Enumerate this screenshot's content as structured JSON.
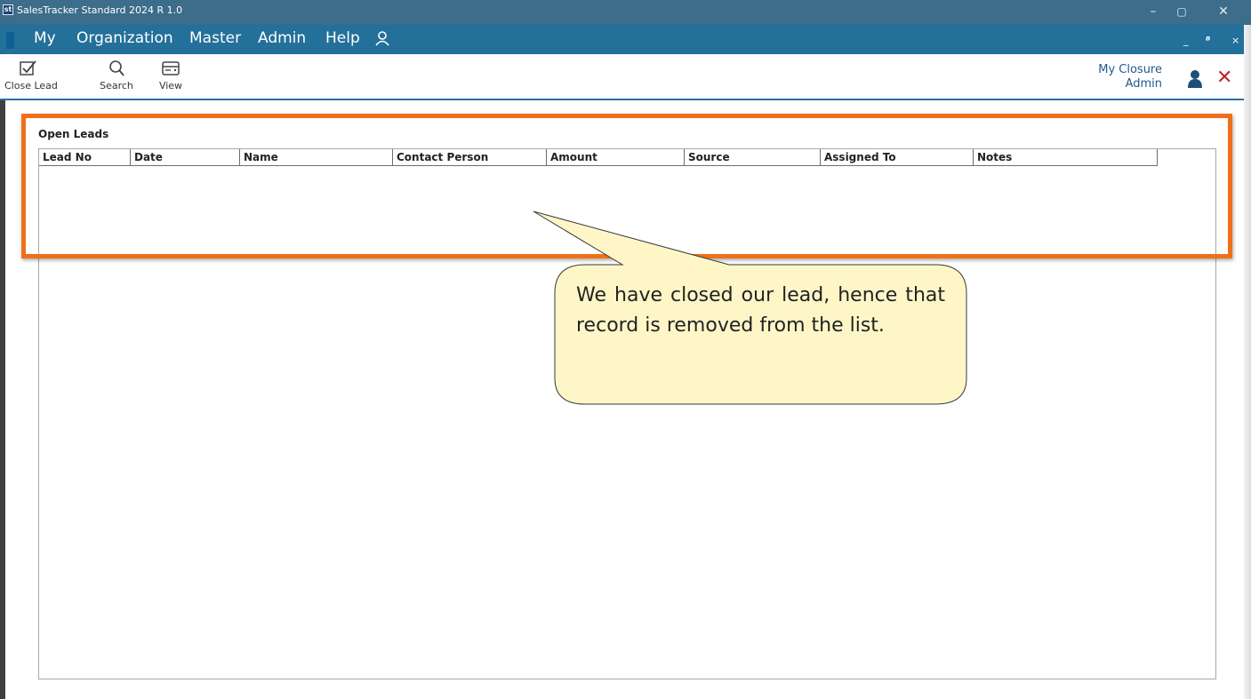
{
  "window": {
    "logo": "st",
    "title": "SalesTracker Standard 2024 R 1.0",
    "controls": [
      "–",
      "▢",
      "✕"
    ]
  },
  "menu": {
    "items": [
      "My",
      "Organization",
      "Master",
      "Admin",
      "Help"
    ],
    "mdi_controls": [
      "_",
      "ᴮ",
      "×"
    ]
  },
  "toolbar": {
    "close_lead": "Close Lead",
    "search": "Search",
    "view": "View",
    "screen_name": "My Closure",
    "user_name": "Admin"
  },
  "content": {
    "section_title": "Open Leads",
    "columns": [
      "Lead No",
      "Date",
      "Name",
      "Contact Person",
      "Amount",
      "Source",
      "Assigned To",
      "Notes"
    ],
    "rows": []
  },
  "callout": {
    "text": "We have closed our lead, hence that record is removed from the list."
  },
  "colors": {
    "titlebar": "#3c6d8a",
    "menubar": "#23709a",
    "highlight": "#f07019",
    "callout_fill": "#fff6c8",
    "close_red": "#c0282b"
  }
}
